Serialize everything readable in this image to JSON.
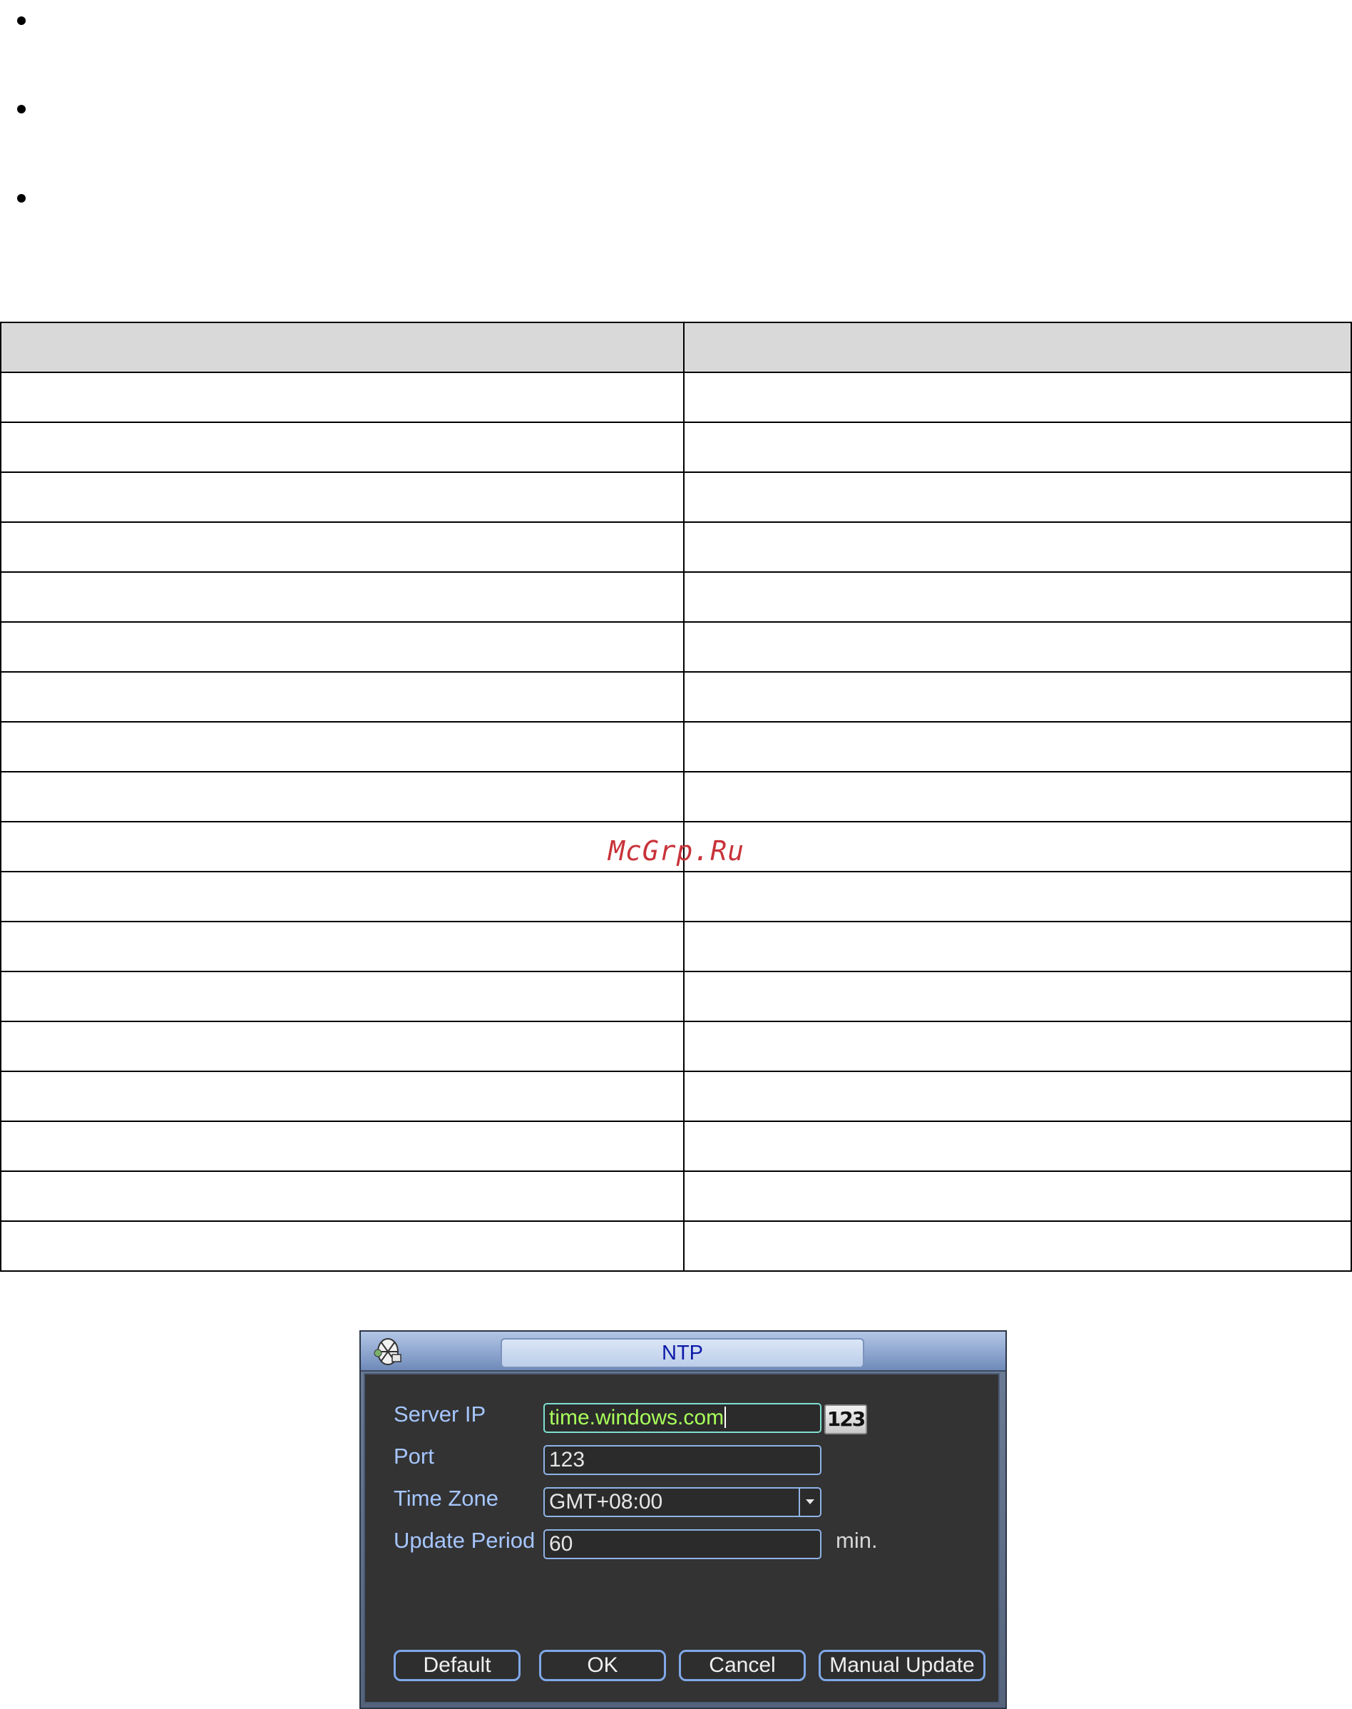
{
  "dialog": {
    "title": "NTP",
    "labels": {
      "server_ip": "Server IP",
      "port": "Port",
      "time_zone": "Time Zone",
      "update_period": "Update Period",
      "min_unit": "min."
    },
    "values": {
      "server_ip": "time.windows.com",
      "port": "123",
      "time_zone": "GMT+08:00",
      "update_period": "60"
    },
    "keyboard_button": "123",
    "buttons": {
      "default": "Default",
      "ok": "OK",
      "cancel": "Cancel",
      "manual_update": "Manual Update"
    }
  },
  "watermark": "McGrp.Ru",
  "icons": {
    "title_icon": "network-globe-icon",
    "dropdown": "chevron-down-icon"
  },
  "colors": {
    "label": "#a6c6ff",
    "active_text": "#a8ff5a",
    "title_text": "#0c1aa8",
    "watermark": "#c8333a"
  }
}
